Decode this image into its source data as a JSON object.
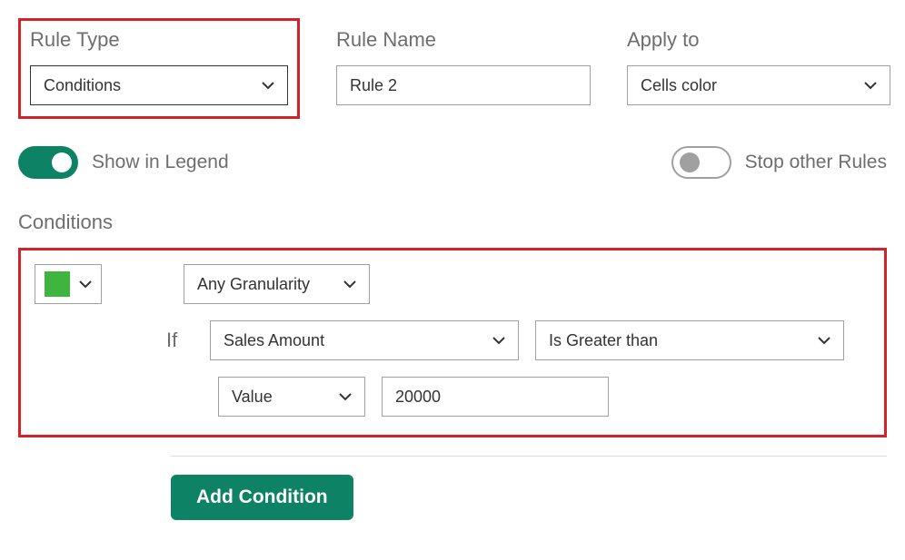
{
  "top": {
    "rule_type": {
      "label": "Rule Type",
      "value": "Conditions"
    },
    "rule_name": {
      "label": "Rule Name",
      "value": "Rule 2"
    },
    "apply_to": {
      "label": "Apply to",
      "value": "Cells color"
    }
  },
  "toggles": {
    "show_legend": {
      "label": "Show in Legend",
      "on": true
    },
    "stop_rules": {
      "label": "Stop other Rules",
      "on": false
    }
  },
  "conditions": {
    "title": "Conditions",
    "color": "#3fb43f",
    "granularity": "Any Granularity",
    "if_label": "If",
    "field": "Sales Amount",
    "operator": "Is Greater than",
    "value_type": "Value",
    "value": "20000"
  },
  "buttons": {
    "add_condition": "Add Condition"
  }
}
